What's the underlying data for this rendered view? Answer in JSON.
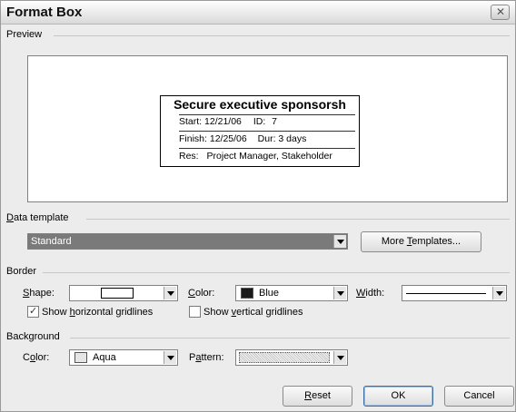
{
  "dialog": {
    "title": "Format Box",
    "close_glyph": "✕"
  },
  "preview": {
    "section_label": "Preview",
    "node": {
      "title": "Secure executive sponsorsh",
      "start_label": "Start:",
      "start_value": "12/21/06",
      "id_label": "ID:",
      "id_value": "7",
      "finish_label": "Finish:",
      "finish_value": "12/25/06",
      "dur_label": "Dur:",
      "dur_value": "3 days",
      "res_label": "Res:",
      "res_value": "Project Manager, Stakeholder"
    }
  },
  "data_template": {
    "section_label_prefix": "",
    "section_label_access": "D",
    "section_label_rest": "ata template",
    "selected": "Standard",
    "more_templates_prefix": "More ",
    "more_templates_access": "T",
    "more_templates_rest": "emplates..."
  },
  "border": {
    "section_label": "Border",
    "shape_access": "S",
    "shape_rest": "hape:",
    "color_access": "C",
    "color_rest": "olor:",
    "color_value": "Blue",
    "color_swatch": "#1a1a1a",
    "width_access": "W",
    "width_rest": "idth:",
    "horizontal_prefix": "Show ",
    "horizontal_access": "h",
    "horizontal_rest": "orizontal gridlines",
    "horizontal_checked": true,
    "vertical_prefix": "Show ",
    "vertical_access": "v",
    "vertical_rest": "ertical gridlines",
    "vertical_checked": false
  },
  "background": {
    "section_label": "Background",
    "color_prefix": "C",
    "color_access": "o",
    "color_rest": "lor:",
    "color_value": "Aqua",
    "color_swatch": "#e6e6e6",
    "pattern_prefix": "P",
    "pattern_access": "a",
    "pattern_rest": "ttern:"
  },
  "buttons": {
    "reset_access": "R",
    "reset_rest": "eset",
    "ok": "OK",
    "cancel": "Cancel"
  },
  "colors": {
    "selection_highlight": "#7a7a7a",
    "dialog_background": "#ececec"
  }
}
